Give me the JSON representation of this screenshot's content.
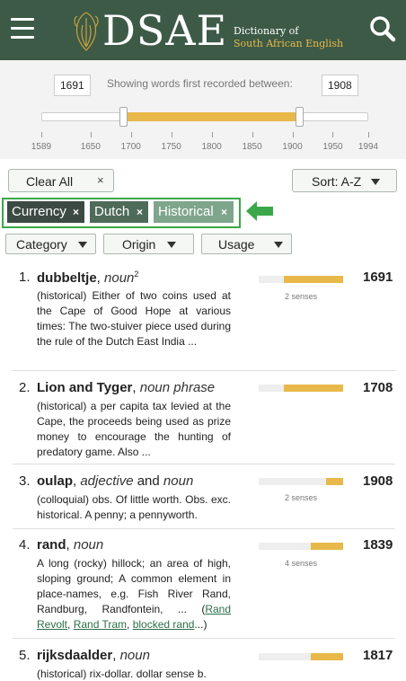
{
  "header": {
    "logo_title": "DSAE",
    "logo_subtitle_1": "Dictionary of",
    "logo_subtitle_2": "South African English"
  },
  "range": {
    "min_year": "1691",
    "max_year": "1908",
    "label": "Showing words first recorded between:",
    "ticks": [
      "1589",
      "1650",
      "1700",
      "1750",
      "1800",
      "1850",
      "1900",
      "1950",
      "1994"
    ]
  },
  "controls": {
    "clear_all": "Clear All",
    "clear_x": "×",
    "sort": "Sort: A-Z"
  },
  "active_filters": [
    {
      "label": "Currency",
      "x": "×"
    },
    {
      "label": "Dutch",
      "x": "×"
    },
    {
      "label": "Historical",
      "x": "×"
    }
  ],
  "dropdowns": {
    "category": "Category",
    "origin": "Origin",
    "usage": "Usage"
  },
  "results": [
    {
      "num": "1.",
      "word": "dubbeltje",
      "sep": ",",
      "pos": "noun",
      "sup": "2",
      "def": "(historical) Either of two coins used at the Cape of Good Hope at various times: The two-stuiver piece used during the rule of the Dutch East India ...",
      "senses": "2 senses",
      "year": "1691",
      "bar_fraction": 0.7
    },
    {
      "num": "2.",
      "word": "Lion and Tyger",
      "sep": ",",
      "pos": "noun phrase",
      "def": "(historical) a per capita tax levied at the Cape, the proceeds being used as prize money to encourage the hunting of predatory game. Also ...",
      "senses": "",
      "year": "1708",
      "bar_fraction": 0.7
    },
    {
      "num": "3.",
      "word": "oulap",
      "sep": ",",
      "pos": "adjective",
      "and": "and",
      "pos2": "noun",
      "def": "(colloquial) obs. Of little worth. Obs. exc. historical. A penny; a pennyworth.",
      "senses": "2 senses",
      "year": "1908",
      "bar_fraction": 0.2
    },
    {
      "num": "4.",
      "word": "rand",
      "sep": ",",
      "pos": "noun",
      "def": "A long (rocky) hillock; an area of high, sloping ground; A common element in place-names, e.g. Fish River Rand, Randburg, Randfontein, ... (",
      "links": [
        "Rand Revolt",
        "Rand Tram",
        "blocked rand"
      ],
      "link_sep": ", ",
      "def_end": "...)",
      "senses": "4 senses",
      "year": "1839",
      "bar_fraction": 0.38
    },
    {
      "num": "5.",
      "word": "rijksdaalder",
      "sep": ",",
      "pos": "noun",
      "def": "(historical) rix-dollar. dollar sense b.",
      "senses": "",
      "year": "1817",
      "bar_fraction": 0.38
    }
  ],
  "colors": {
    "header": "#3d5a47",
    "accent": "#e8b94a",
    "highlight_border": "#3aa84a"
  }
}
